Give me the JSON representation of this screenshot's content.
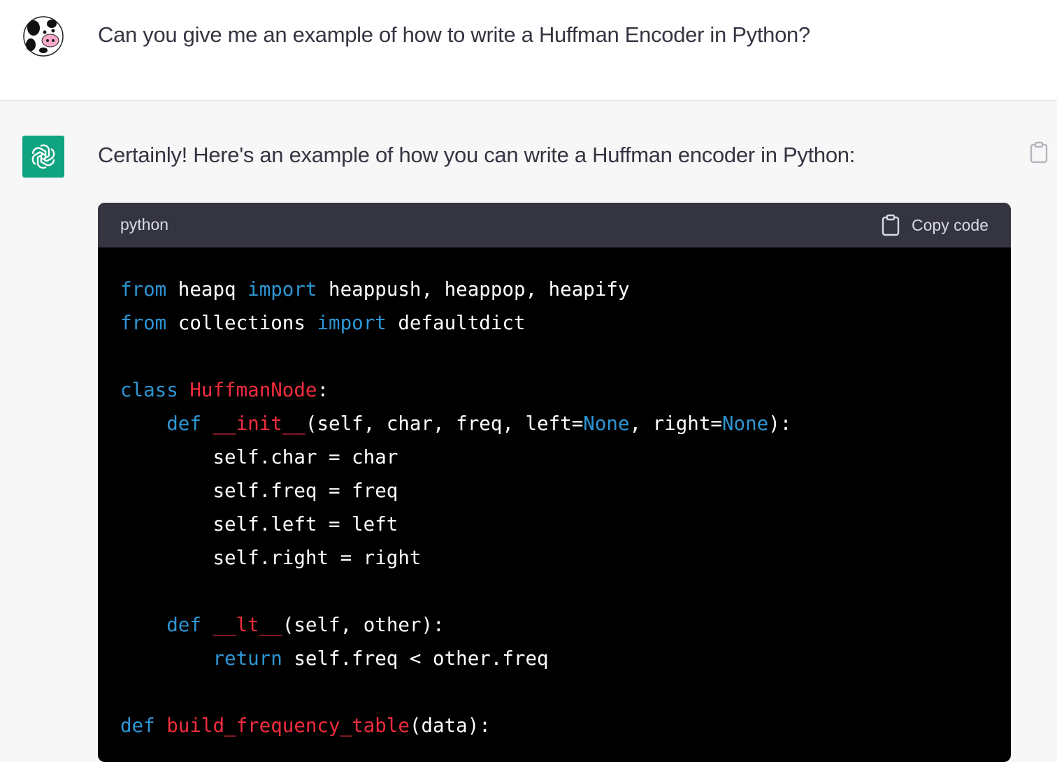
{
  "user_message": "Can you give me an example of how to write a Huffman Encoder in Python?",
  "assistant_message": "Certainly! Here's an example of how you can write a Huffman encoder in Python:",
  "code": {
    "language": "python",
    "copy_label": "Copy code",
    "lines": [
      [
        {
          "t": "from",
          "c": "kw"
        },
        {
          "t": " heapq ",
          "c": "tok"
        },
        {
          "t": "import",
          "c": "kw"
        },
        {
          "t": " heappush, heappop, heapify",
          "c": "tok"
        }
      ],
      [
        {
          "t": "from",
          "c": "kw"
        },
        {
          "t": " collections ",
          "c": "tok"
        },
        {
          "t": "import",
          "c": "kw"
        },
        {
          "t": " defaultdict",
          "c": "tok"
        }
      ],
      [],
      [
        {
          "t": "class",
          "c": "kw"
        },
        {
          "t": " ",
          "c": "tok"
        },
        {
          "t": "HuffmanNode",
          "c": "cls"
        },
        {
          "t": ":",
          "c": "tok"
        }
      ],
      [
        {
          "t": "    ",
          "c": "tok"
        },
        {
          "t": "def",
          "c": "kw"
        },
        {
          "t": " ",
          "c": "tok"
        },
        {
          "t": "__init__",
          "c": "cls"
        },
        {
          "t": "(self, char, freq, left=",
          "c": "tok"
        },
        {
          "t": "None",
          "c": "kw"
        },
        {
          "t": ", right=",
          "c": "tok"
        },
        {
          "t": "None",
          "c": "kw"
        },
        {
          "t": "):",
          "c": "tok"
        }
      ],
      [
        {
          "t": "        self.char = char",
          "c": "tok"
        }
      ],
      [
        {
          "t": "        self.freq = freq",
          "c": "tok"
        }
      ],
      [
        {
          "t": "        self.left = left",
          "c": "tok"
        }
      ],
      [
        {
          "t": "        self.right = right",
          "c": "tok"
        }
      ],
      [],
      [
        {
          "t": "    ",
          "c": "tok"
        },
        {
          "t": "def",
          "c": "kw"
        },
        {
          "t": " ",
          "c": "tok"
        },
        {
          "t": "__lt__",
          "c": "cls"
        },
        {
          "t": "(self, other):",
          "c": "tok"
        }
      ],
      [
        {
          "t": "        ",
          "c": "tok"
        },
        {
          "t": "return",
          "c": "kw"
        },
        {
          "t": " self.freq < other.freq",
          "c": "tok"
        }
      ],
      [],
      [
        {
          "t": "def",
          "c": "kw"
        },
        {
          "t": " ",
          "c": "tok"
        },
        {
          "t": "build_frequency_table",
          "c": "cls"
        },
        {
          "t": "(data):",
          "c": "tok"
        }
      ]
    ]
  },
  "icons": {
    "user_avatar": "cow-avatar-icon",
    "bot_avatar": "openai-logo-icon",
    "copy": "clipboard-icon"
  },
  "colors": {
    "keyword": "#2e95d3",
    "class_name": "#f22c3d",
    "bot_avatar_bg": "#10a37f",
    "code_header_bg": "#343541",
    "code_bg": "#000000"
  }
}
